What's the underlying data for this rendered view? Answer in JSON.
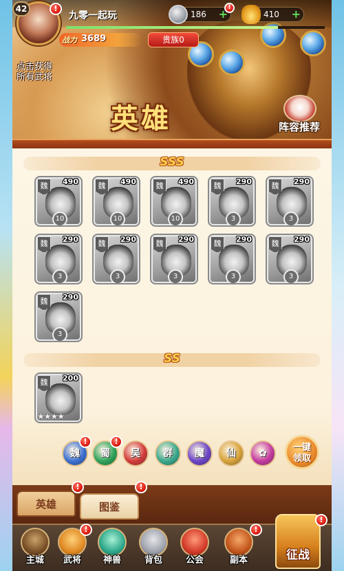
{
  "player": {
    "level": "42",
    "name": "九零一起玩",
    "power_label": "战力",
    "power_value": "3689",
    "noble": "贵族0",
    "exp_progress": 0.82
  },
  "currency": {
    "coins": "186",
    "ingots": "410"
  },
  "banner": {
    "tip_line1": "点击获得",
    "tip_line2": "所有武将",
    "title": "英雄",
    "lineup_label": "阵容推荐"
  },
  "tiers": [
    {
      "label": "SSS"
    },
    {
      "label": "SS"
    }
  ],
  "cards": [
    {
      "faction": "魏",
      "power": "490",
      "badge": "10"
    },
    {
      "faction": "魏",
      "power": "490",
      "badge": "10"
    },
    {
      "faction": "魏",
      "power": "490",
      "badge": "10"
    },
    {
      "faction": "魏",
      "power": "290",
      "badge": "3"
    },
    {
      "faction": "魏",
      "power": "290",
      "badge": "3"
    },
    {
      "faction": "魏",
      "power": "290",
      "badge": "3"
    },
    {
      "faction": "魏",
      "power": "290",
      "badge": "3"
    },
    {
      "faction": "魏",
      "power": "290",
      "badge": "3"
    },
    {
      "faction": "魏",
      "power": "290",
      "badge": "3"
    },
    {
      "faction": "魏",
      "power": "290",
      "badge": "3"
    },
    {
      "faction": "魏",
      "power": "290",
      "badge": "3"
    },
    {
      "faction": "魏",
      "power": "200",
      "stars": "★★★★"
    }
  ],
  "factions": [
    "魏",
    "蜀",
    "吴",
    "群",
    "魔",
    "仙"
  ],
  "claim_button": {
    "line1": "一键",
    "line2": "领取"
  },
  "tabs": {
    "heroes": "英雄",
    "codex": "图鉴"
  },
  "nav": {
    "city": "主城",
    "generals": "武将",
    "beasts": "神兽",
    "bag": "背包",
    "guild": "公会",
    "dungeon": "副本",
    "battle": "征战"
  },
  "colors": {
    "wei": "#3b6fd1",
    "shu": "#2ea35a",
    "wu": "#d23b3b",
    "qun": "#3aa88c",
    "mo": "#6b45c7",
    "xian": "#d9a33a",
    "special": "#c43aa0"
  }
}
